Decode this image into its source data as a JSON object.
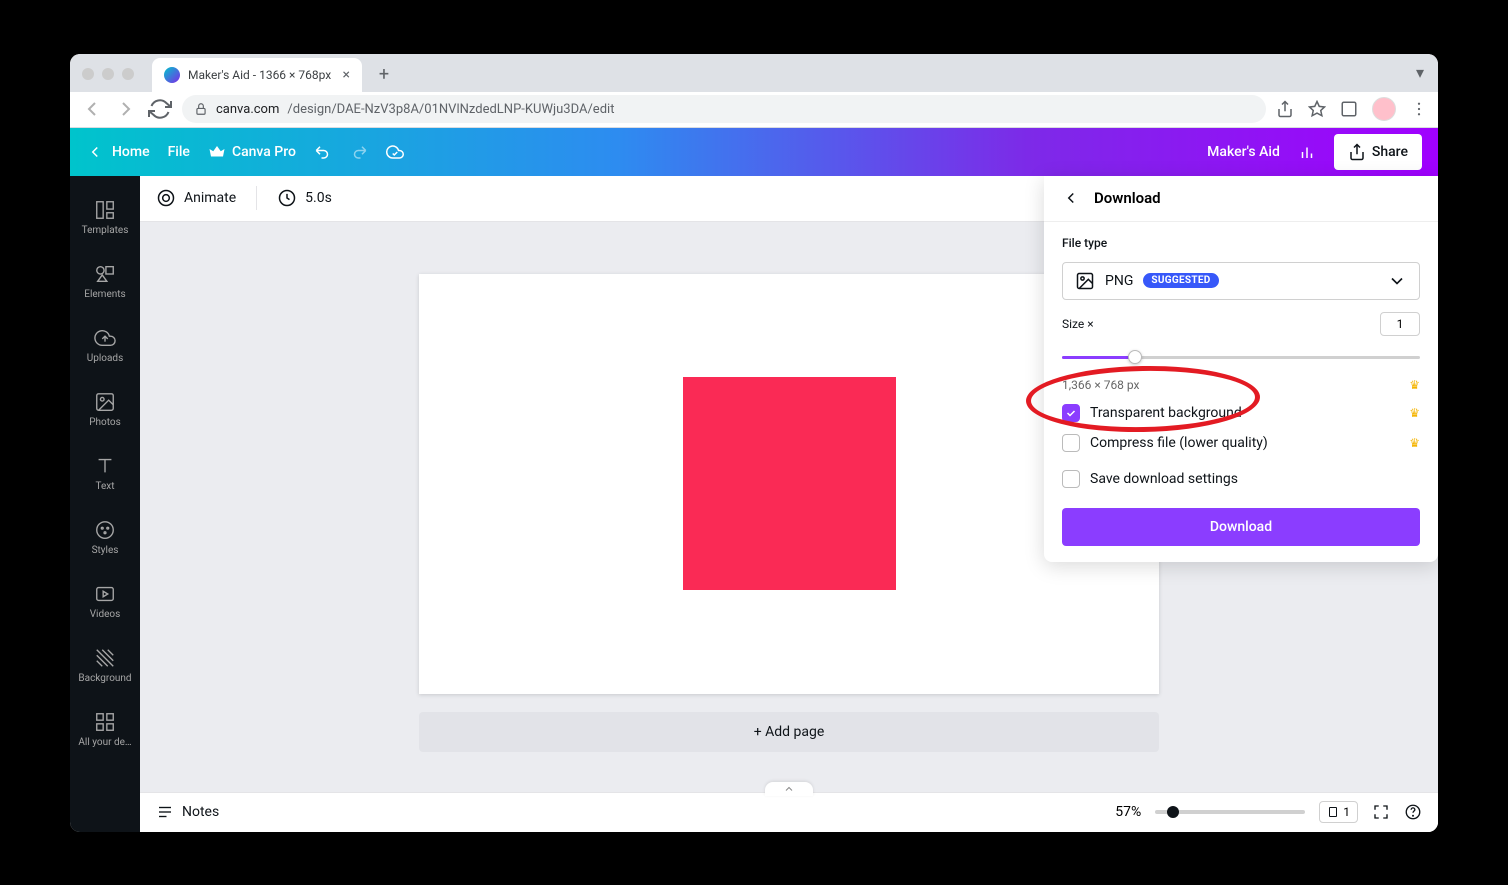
{
  "browser": {
    "tab_title": "Maker's Aid - 1366 × 768px",
    "url_host": "canva.com",
    "url_path": "/design/DAE-NzV3p8A/01NVlNzdedLNP-KUWju3DA/edit"
  },
  "header": {
    "home": "Home",
    "file": "File",
    "pro": "Canva Pro",
    "doc_name": "Maker's Aid",
    "share": "Share"
  },
  "rail": {
    "items": [
      {
        "label": "Templates"
      },
      {
        "label": "Elements"
      },
      {
        "label": "Uploads"
      },
      {
        "label": "Photos"
      },
      {
        "label": "Text"
      },
      {
        "label": "Styles"
      },
      {
        "label": "Videos"
      },
      {
        "label": "Background"
      },
      {
        "label": "All your de…"
      }
    ]
  },
  "toolbar": {
    "animate": "Animate",
    "duration": "5.0s"
  },
  "canvas": {
    "add_page": "+ Add page",
    "square_color": "#fa2a55"
  },
  "footer": {
    "notes": "Notes",
    "zoom": "57%",
    "page_indicator": "1"
  },
  "download": {
    "title": "Download",
    "file_type_label": "File type",
    "file_type_value": "PNG",
    "suggested_badge": "SUGGESTED",
    "size_label": "Size ×",
    "size_value": "1",
    "dimensions": "1,366 × 768 px",
    "transparent_label": "Transparent background",
    "compress_label": "Compress file (lower quality)",
    "save_settings_label": "Save download settings",
    "button": "Download",
    "transparent_checked": true,
    "compress_checked": false,
    "save_checked": false
  }
}
